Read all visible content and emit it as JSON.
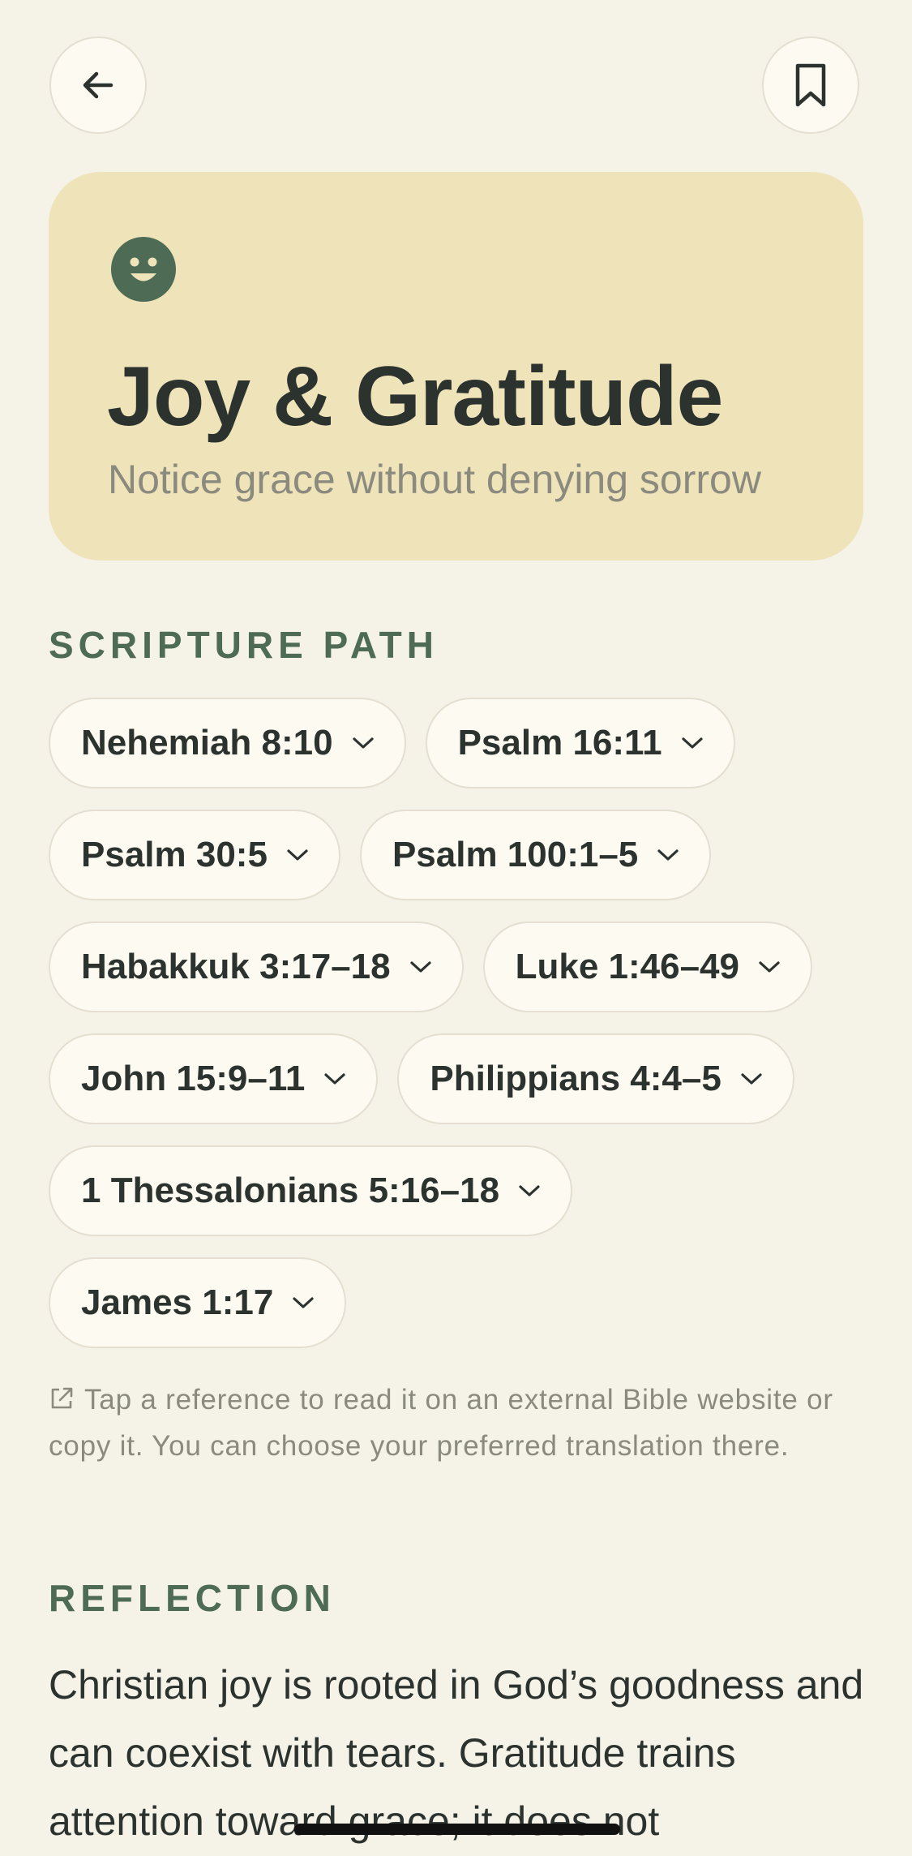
{
  "header": {
    "back_icon": "arrow-left-icon",
    "bookmark_icon": "bookmark-icon"
  },
  "hero": {
    "icon": "smiley-face-icon",
    "title": "Joy & Gratitude",
    "subtitle": "Notice grace without denying sorrow",
    "background_color": "#efe3b9",
    "icon_color": "#4d6b55"
  },
  "scripture": {
    "heading": "SCRIPTURE PATH",
    "references": [
      "Nehemiah 8:10",
      "Psalm 16:11",
      "Psalm 30:5",
      "Psalm 100:1–5",
      "Habakkuk 3:17–18",
      "Luke 1:46–49",
      "John 15:9–11",
      "Philippians 4:4–5",
      "1 Thessalonians 5:16–18",
      "James 1:17"
    ],
    "chip_icon": "chevron-down-icon",
    "note_icon": "external-link-icon",
    "note": "Tap a reference to read it on an external Bible website or copy it. You can choose your preferred translation there."
  },
  "reflection": {
    "heading": "REFLECTION",
    "body": "Christian joy is rooted in God’s goodness and can coexist with tears. Gratitude trains attention toward grace; it does not"
  },
  "colors": {
    "page_background": "#f5f2e8",
    "accent_green": "#4d6b55",
    "text_dark": "#2c332f",
    "text_muted": "#8b8a7f"
  }
}
